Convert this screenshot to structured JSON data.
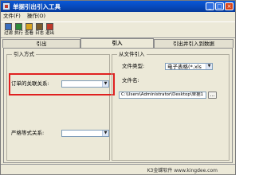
{
  "window": {
    "title": "单据引出引入工具",
    "caption_buttons": {
      "minimize": "_",
      "maximize": "□",
      "close": "×"
    }
  },
  "menu": {
    "items": [
      "文件(F)",
      "操作(O)"
    ]
  },
  "toolbar": {
    "items": [
      {
        "label": "过滤",
        "icon": "filter-icon",
        "color": "#3a6fc0"
      },
      {
        "label": "执行",
        "icon": "execute-icon",
        "color": "#2e8b3a"
      },
      {
        "label": "查看",
        "icon": "view-icon",
        "color": "#d6a21e"
      },
      {
        "label": "日志",
        "icon": "log-icon",
        "color": "#7a5c2e"
      },
      {
        "label": "退出",
        "icon": "exit-icon",
        "color": "#c0392b"
      }
    ]
  },
  "tabs": [
    {
      "label": "引出",
      "active": false
    },
    {
      "label": "引入",
      "active": true
    },
    {
      "label": "引出并引入到数据",
      "active": false
    }
  ],
  "import_mode": {
    "title": "引入方式",
    "order_relation_label": "订单的关联关系:",
    "order_relation_value": "",
    "strict_relation_label": "严格等式关系:",
    "strict_relation_value": ""
  },
  "file_import": {
    "title": "从文件引入",
    "file_type_label": "文件类型:",
    "file_type_value": "电子表格(*.xls",
    "file_name_label": "文件名:",
    "file_path_value": "C:\\Users\\Administrator\\Desktop\\单据1",
    "browse_label": "..."
  },
  "status": {
    "text": "K3金蝶软件 www.kingdee.com"
  },
  "colors": {
    "title_bar": "#0a58d8",
    "highlight": "#e02020",
    "selection": "#316ac5",
    "window_bg": "#ece9d8"
  }
}
